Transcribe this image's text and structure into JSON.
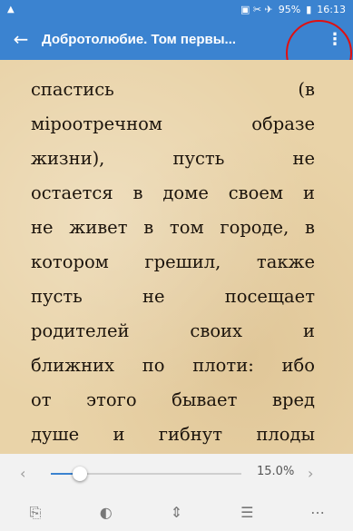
{
  "status_bar": {
    "left_icon": "warning-icon",
    "signal_icons": "▣ ✂ ✈",
    "battery": "95%",
    "time": "16:13"
  },
  "app_bar": {
    "title": "Добротолюбие. Том первы...",
    "back_icon": "back-arrow-icon",
    "menu_icon": "more-vert-icon"
  },
  "reader": {
    "lines": [
      "спастись (в",
      "міроотречном образе",
      "жизни), пусть не",
      "остается в доме своем и",
      "не живет в том городе, в",
      "котором грешил, также",
      "пусть не посещает",
      "родителей своих и",
      "ближних по плоти: ибо",
      "от этого бывает вред",
      "душе и гибнут плоды"
    ]
  },
  "progress": {
    "percent_label": "15.0%",
    "fraction": 0.15,
    "prev_label": "‹",
    "next_label": "›"
  },
  "toolbar": {
    "items": [
      {
        "name": "rotate-icon",
        "glyph": "⎘"
      },
      {
        "name": "theme-icon",
        "glyph": "◐"
      },
      {
        "name": "scroll-mode-icon",
        "glyph": "⇕"
      },
      {
        "name": "contents-icon",
        "glyph": "☰"
      },
      {
        "name": "more-icon",
        "glyph": "⋯"
      }
    ]
  },
  "colors": {
    "accent": "#3b83d0",
    "paper": "#e9d3a8",
    "annotation": "#e01010"
  }
}
